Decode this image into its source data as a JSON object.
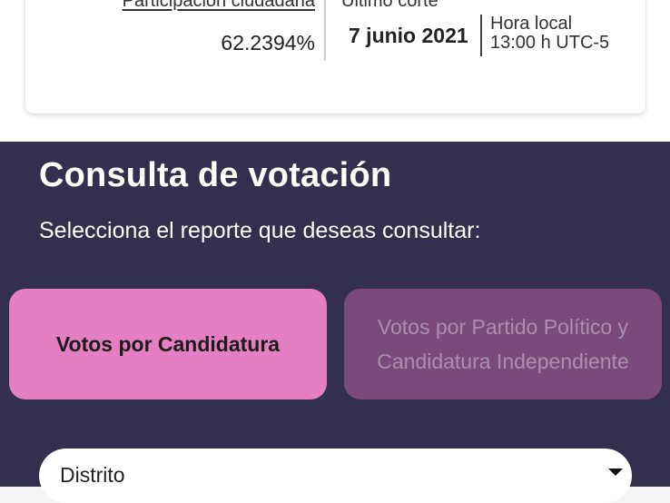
{
  "stats": {
    "participacion_label": "Participación ciudadana",
    "participacion_value": "62.2394%",
    "corte_label": "Último corte",
    "corte_date": "7 junio 2021",
    "hora_label": "Hora local",
    "hora_value": "13:00 h UTC-5"
  },
  "consulta": {
    "title": "Consulta de votación",
    "subtitle": "Selecciona el reporte que deseas consultar:",
    "btn_candidatura": "Votos por Candidatura",
    "btn_partido_line1": "Votos por Partido Político y",
    "btn_partido_line2": "Candidatura Independiente",
    "select_value": "Distrito",
    "select_icon": "caret-down-icon"
  },
  "colors": {
    "dark_bg": "#332f4f",
    "active_button": "#e57fc3",
    "inactive_button": "#7a4a7c"
  }
}
